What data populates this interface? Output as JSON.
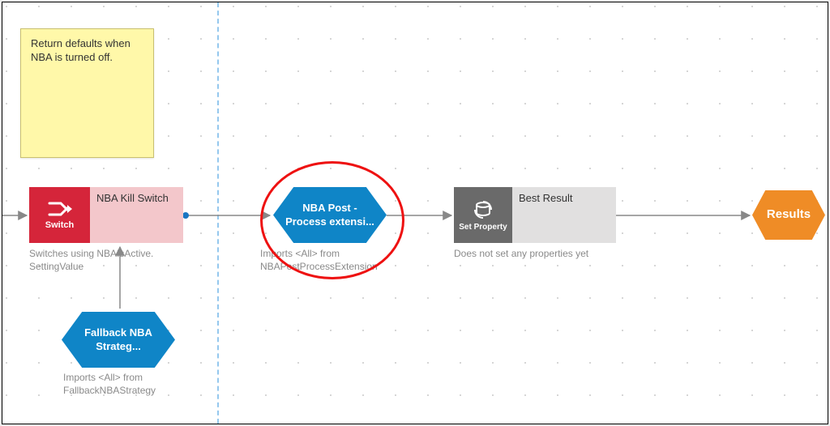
{
  "note": {
    "text": "Return defaults when NBA is turned off."
  },
  "switch": {
    "icon_label": "Switch",
    "title": "NBA Kill Switch",
    "desc": "Switches using NBAIsActive. SettingValue"
  },
  "fallback": {
    "title": "Fallback NBA Strateg...",
    "desc": "Imports <All> from FallbackNBAStrategy"
  },
  "nba_post": {
    "title": "NBA Post -Process extensi...",
    "desc": "Imports <All> from NBAPostProcessExtension"
  },
  "setprop": {
    "icon_label": "Set Property",
    "title": "Best Result",
    "desc": "Does not set any properties yet"
  },
  "results": {
    "title": "Results"
  }
}
